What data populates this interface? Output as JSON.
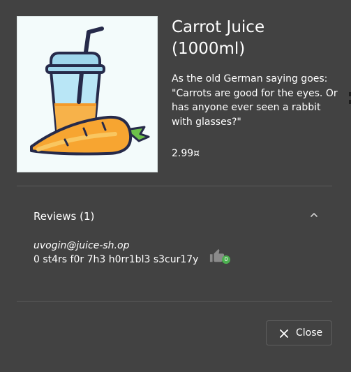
{
  "product": {
    "name": "Carrot Juice (1000ml)",
    "description": "As the old German saying goes: \"Carrots are good for the eyes. Or has anyone ever seen a rabbit with glasses?\"",
    "price": "2.99¤",
    "image_icon": "carrot-juice-image"
  },
  "reviews": {
    "title": "Reviews (1)",
    "expanded": true,
    "items": [
      {
        "author": "uvogin@juice-sh.op",
        "message": "0 st4rs f0r 7h3 h0rr1bl3 s3cur17y",
        "likes": "0"
      }
    ]
  },
  "actions": {
    "close_label": "Close"
  },
  "colors": {
    "dialog_background": "#424242",
    "text": "#ffffff",
    "like_badge": "#4caf50",
    "divider": "#5c5c5c"
  }
}
